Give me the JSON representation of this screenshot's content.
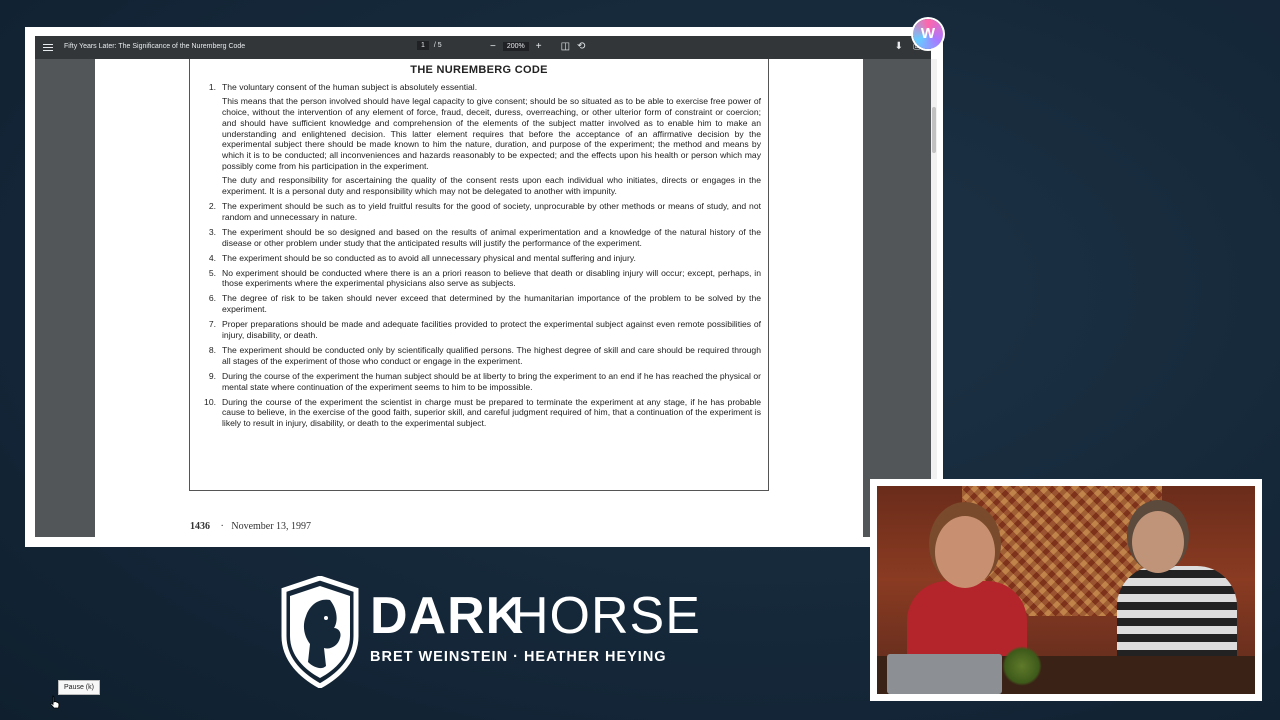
{
  "pdf_toolbar": {
    "title": "Fifty Years Later: The Significance of the Nuremberg Code",
    "page_current": "1",
    "page_total": "/ 5",
    "zoom_out": "−",
    "zoom_level": "200%",
    "zoom_in": "+"
  },
  "document": {
    "heading": "THE NUREMBERG CODE",
    "items": [
      {
        "num": "1.",
        "text": "The voluntary consent of the human subject is absolutely essential.",
        "sub": [
          "This means that the person involved should have legal capacity to give consent; should be so situated as to be able to exercise free power of choice, without the intervention of any element of force, fraud, deceit, duress, overreaching, or other ulterior form of constraint or coercion; and should have sufficient knowledge and comprehension of the elements of the subject matter involved as to enable him to make an understanding and enlightened decision. This latter element requires that before the acceptance of an affirmative decision by the experimental subject there should be made known to him the nature, duration, and purpose of the experiment; the method and means by which it is to be conducted; all inconveniences and hazards reasonably to be expected; and the effects upon his health or person which may possibly come from his participation in the experiment.",
          "The duty and responsibility for ascertaining the quality of the consent rests upon each individual who initiates, directs or engages in the experiment. It is a personal duty and responsibility which may not be delegated to another with impunity."
        ]
      },
      {
        "num": "2.",
        "text": "The experiment should be such as to yield fruitful results for the good of society, unprocurable by other methods or means of study, and not random and unnecessary in nature."
      },
      {
        "num": "3.",
        "text": "The experiment should be so designed and based on the results of animal experimentation and a knowledge of the natural history of the disease or other problem under study that the anticipated results will justify the performance of the experiment."
      },
      {
        "num": "4.",
        "text": "The experiment should be so conducted as to avoid all unnecessary physical and mental suffering and injury."
      },
      {
        "num": "5.",
        "text": "No experiment should be conducted where there is an a priori reason to believe that death or disabling injury will occur; except, perhaps, in those experiments where the experimental physicians also serve as subjects."
      },
      {
        "num": "6.",
        "text": "The degree of risk to be taken should never exceed that determined by the humanitarian importance of the problem to be solved by the experiment."
      },
      {
        "num": "7.",
        "text": "Proper preparations should be made and adequate facilities provided to protect the experimental subject against even remote possibilities of injury, disability, or death."
      },
      {
        "num": "8.",
        "text": "The experiment should be conducted only by scientifically qualified persons. The highest degree of skill and care should be required through all stages of the experiment of those who conduct or engage in the experiment."
      },
      {
        "num": "9.",
        "text": "During the course of the experiment the human subject should be at liberty to bring the experiment to an end if he has reached the physical or mental state where continuation of the experiment seems to him to be impossible."
      },
      {
        "num": "10.",
        "text": "During the course of the experiment the scientist in charge must be prepared to terminate the experiment at any stage, if he has probable cause to believe, in the exercise of the good faith, superior skill, and careful judgment required of him, that a continuation of the experiment is likely to result in injury, disability, or death to the experimental subject."
      }
    ],
    "footer_page": "1436",
    "footer_sep": "·",
    "footer_date": "November 13, 1997"
  },
  "branding": {
    "brand_bold": "DARK",
    "brand_light": "HORSE",
    "subtitle": "BRET WEINSTEIN · HEATHER HEYING"
  },
  "tooltip": {
    "text": "Pause (k)"
  },
  "icons": {
    "menu": "hamburger-menu-icon",
    "download": "download-icon",
    "print": "print-icon",
    "fit": "fit-page-icon",
    "rotate": "rotate-icon",
    "extension": "extension-w-icon",
    "shield": "horse-shield-logo",
    "cursor": "mouse-cursor-icon"
  },
  "colors": {
    "background": "#15283a",
    "pdf_toolbar": "#323639",
    "pdf_viewport": "#525659"
  }
}
